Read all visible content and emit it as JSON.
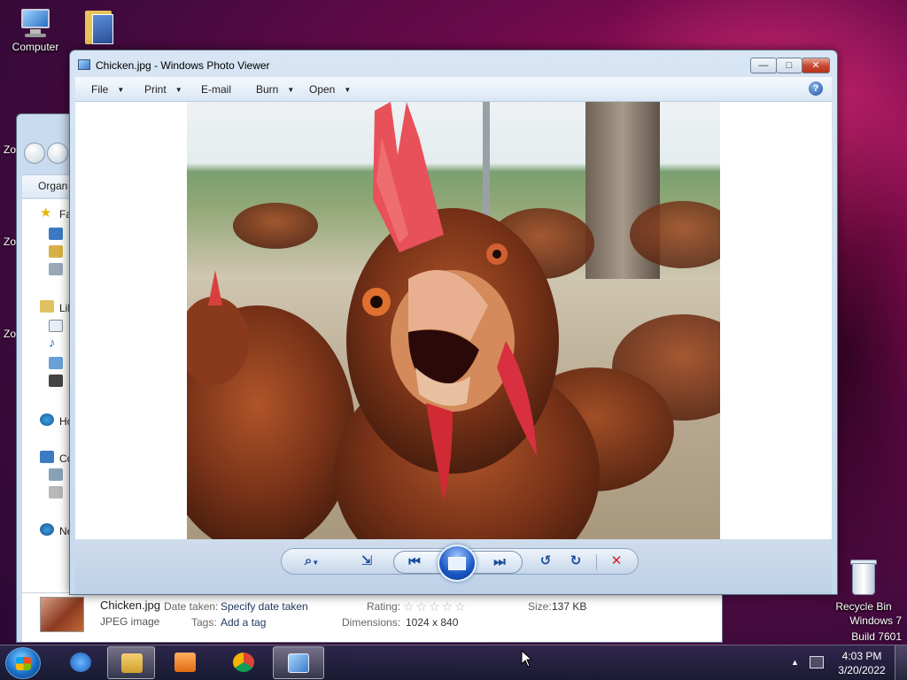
{
  "desktop": {
    "icons": [
      {
        "label": "Computer"
      },
      {
        "label": "Recycle Bin"
      }
    ],
    "watermark": {
      "line1": "Windows 7",
      "line2": "Build 7601"
    },
    "clipped_labels": [
      "Zo",
      "Zo",
      "Zo"
    ]
  },
  "explorer": {
    "toolbar_label": "Organ",
    "sidebar": {
      "favorites": "Fa",
      "libraries": "Lib",
      "homegroup": "Ho",
      "computer": "Co",
      "network": "Ne"
    },
    "details": {
      "filename": "Chicken.jpg",
      "filetype": "JPEG image",
      "date_taken_label": "Date taken:",
      "date_taken_value": "Specify date taken",
      "tags_label": "Tags:",
      "tags_value": "Add a tag",
      "rating_label": "Rating:",
      "rating_stars": "☆☆☆☆☆",
      "dimensions_label": "Dimensions:",
      "dimensions_value": "1024 x 840",
      "size_label": "Size:",
      "size_value": "137 KB"
    }
  },
  "photo_viewer": {
    "title": "Chicken.jpg - Windows Photo Viewer",
    "menu": [
      {
        "label": "File"
      },
      {
        "label": "Print"
      },
      {
        "label": "E-mail"
      },
      {
        "label": "Burn"
      },
      {
        "label": "Open"
      }
    ],
    "help_glyph": "?",
    "caption": {
      "minimize": "—",
      "maximize": "□",
      "close": "✕"
    },
    "controls": {
      "zoom": "⌕",
      "actual_size": "⇲",
      "previous": "⏮",
      "next": "⏭",
      "rotate_ccw": "↺",
      "rotate_cw": "↻",
      "delete": "✕"
    }
  },
  "taskbar": {
    "time": "4:03 PM",
    "date": "3/20/2022"
  },
  "colors": {
    "accent": "#1a56c4",
    "delete_red": "#d02020",
    "desktop": "#6a0a4a"
  }
}
